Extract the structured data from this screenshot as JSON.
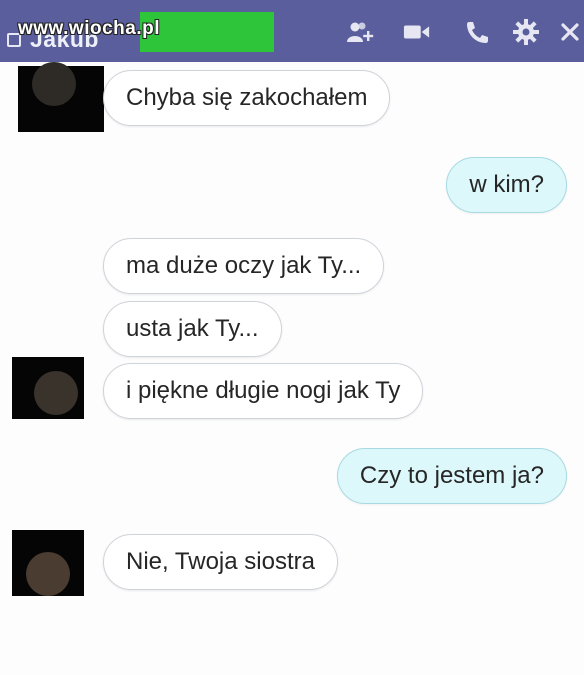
{
  "header": {
    "contact_name": "Jakub",
    "watermark": "www.wiocha.pl",
    "background_color": "#5a5e9c",
    "icons": [
      "add-person-icon",
      "video-call-icon",
      "phone-icon",
      "gear-icon",
      "close-icon"
    ]
  },
  "messages": [
    {
      "direction": "in",
      "text": "Chyba się zakochałem"
    },
    {
      "direction": "out",
      "text": "w kim?"
    },
    {
      "direction": "in",
      "text": "ma duże oczy jak Ty..."
    },
    {
      "direction": "in",
      "text": "usta jak Ty..."
    },
    {
      "direction": "in",
      "text": "i piękne długie nogi jak Ty"
    },
    {
      "direction": "out",
      "text": "Czy to jestem ja?"
    },
    {
      "direction": "in",
      "text": "Nie, Twoja siostra"
    }
  ],
  "colors": {
    "incoming_bubble": "#ffffff",
    "outgoing_bubble": "#dcf8fb",
    "redaction_green": "#2fc53a"
  }
}
